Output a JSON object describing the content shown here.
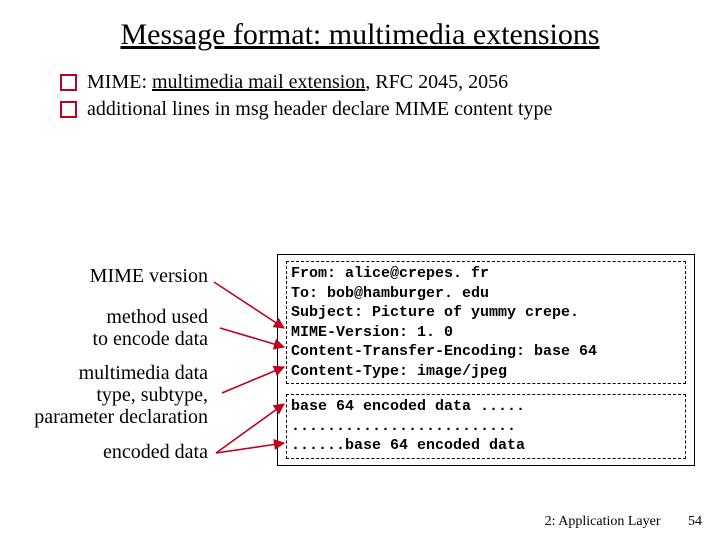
{
  "title": "Message format: multimedia extensions",
  "bullets": {
    "b1_pre": "MIME: ",
    "b1_ul": "multimedia mail extension",
    "b1_post": ", RFC 2045, 2056",
    "b2": "additional lines in msg header declare MIME content type"
  },
  "labels": {
    "l1": "MIME version",
    "l2": "method used\nto encode data",
    "l3": "multimedia data\ntype, subtype,\nparameter declaration",
    "l4": "encoded data"
  },
  "header_lines": {
    "h1": "From: alice@crepes. fr",
    "h2": "To: bob@hamburger. edu",
    "h3": "Subject: Picture of yummy crepe.",
    "h4": "MIME-Version: 1. 0",
    "h5": "Content-Transfer-Encoding: base 64",
    "h6": "Content-Type: image/jpeg"
  },
  "body_lines": {
    "d1": "base 64 encoded data .....",
    "d2": ".........................",
    "d3": "......base 64 encoded data"
  },
  "footer": {
    "chapter": "2: Application Layer",
    "page": "54"
  }
}
